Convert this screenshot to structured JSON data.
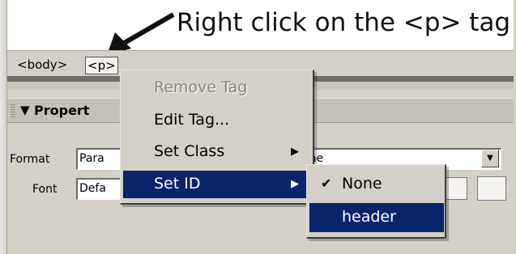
{
  "annotation": {
    "text": "Right click on the <p> tag"
  },
  "tag_selector": {
    "body_tag": "<body>",
    "p_tag": "<p>"
  },
  "properties": {
    "title": "Propert",
    "format_label": "Format",
    "format_value": "Para",
    "font_label": "Font",
    "font_value": "Defa",
    "style_value": "one"
  },
  "context_menu": {
    "items": [
      {
        "label": "Remove Tag",
        "disabled": true
      },
      {
        "label": "Edit Tag...",
        "disabled": false
      },
      {
        "label": "Set Class",
        "has_submenu": true
      },
      {
        "label": "Set ID",
        "has_submenu": true,
        "selected": true
      }
    ]
  },
  "submenu": {
    "items": [
      {
        "label": "None",
        "checked": true
      },
      {
        "label": "header",
        "selected": true
      }
    ]
  },
  "colors": {
    "menu_highlight": "#0a246a",
    "chrome": "#d4d0c8"
  }
}
